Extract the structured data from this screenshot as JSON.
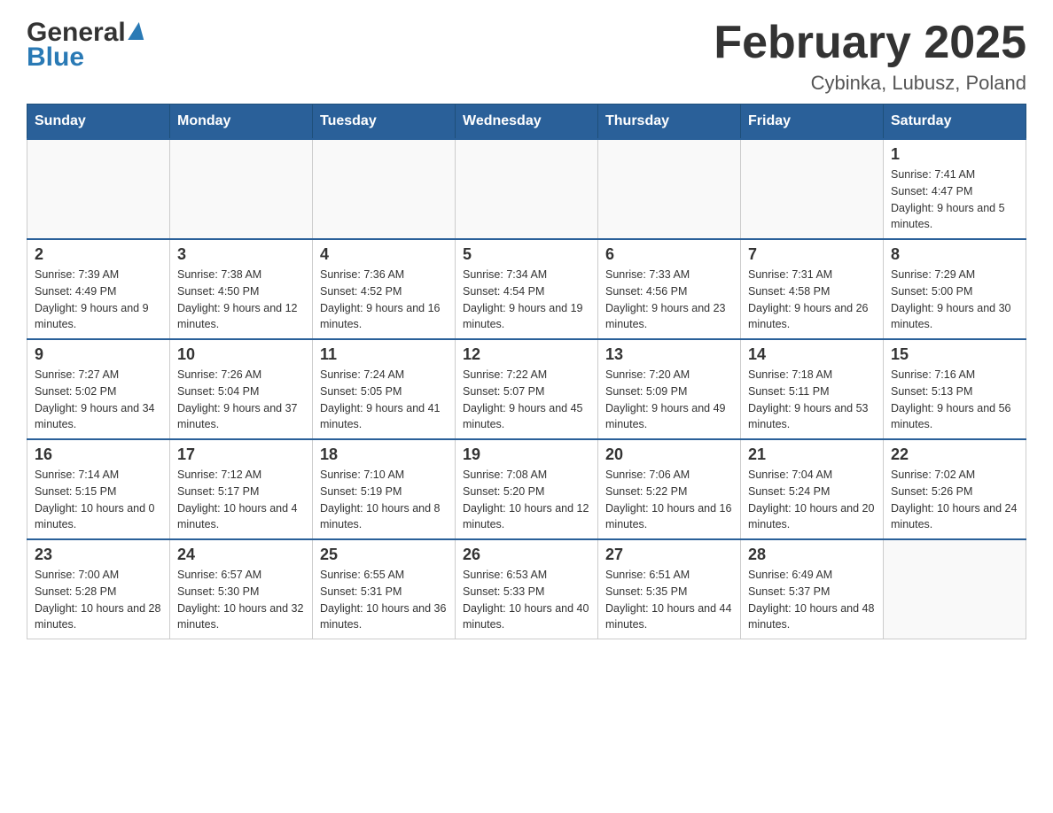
{
  "header": {
    "logo_line1": "General",
    "logo_line2": "Blue",
    "title": "February 2025",
    "subtitle": "Cybinka, Lubusz, Poland"
  },
  "weekdays": [
    "Sunday",
    "Monday",
    "Tuesday",
    "Wednesday",
    "Thursday",
    "Friday",
    "Saturday"
  ],
  "weeks": [
    {
      "days": [
        {
          "num": "",
          "info": ""
        },
        {
          "num": "",
          "info": ""
        },
        {
          "num": "",
          "info": ""
        },
        {
          "num": "",
          "info": ""
        },
        {
          "num": "",
          "info": ""
        },
        {
          "num": "",
          "info": ""
        },
        {
          "num": "1",
          "info": "Sunrise: 7:41 AM\nSunset: 4:47 PM\nDaylight: 9 hours and 5 minutes."
        }
      ]
    },
    {
      "days": [
        {
          "num": "2",
          "info": "Sunrise: 7:39 AM\nSunset: 4:49 PM\nDaylight: 9 hours and 9 minutes."
        },
        {
          "num": "3",
          "info": "Sunrise: 7:38 AM\nSunset: 4:50 PM\nDaylight: 9 hours and 12 minutes."
        },
        {
          "num": "4",
          "info": "Sunrise: 7:36 AM\nSunset: 4:52 PM\nDaylight: 9 hours and 16 minutes."
        },
        {
          "num": "5",
          "info": "Sunrise: 7:34 AM\nSunset: 4:54 PM\nDaylight: 9 hours and 19 minutes."
        },
        {
          "num": "6",
          "info": "Sunrise: 7:33 AM\nSunset: 4:56 PM\nDaylight: 9 hours and 23 minutes."
        },
        {
          "num": "7",
          "info": "Sunrise: 7:31 AM\nSunset: 4:58 PM\nDaylight: 9 hours and 26 minutes."
        },
        {
          "num": "8",
          "info": "Sunrise: 7:29 AM\nSunset: 5:00 PM\nDaylight: 9 hours and 30 minutes."
        }
      ]
    },
    {
      "days": [
        {
          "num": "9",
          "info": "Sunrise: 7:27 AM\nSunset: 5:02 PM\nDaylight: 9 hours and 34 minutes."
        },
        {
          "num": "10",
          "info": "Sunrise: 7:26 AM\nSunset: 5:04 PM\nDaylight: 9 hours and 37 minutes."
        },
        {
          "num": "11",
          "info": "Sunrise: 7:24 AM\nSunset: 5:05 PM\nDaylight: 9 hours and 41 minutes."
        },
        {
          "num": "12",
          "info": "Sunrise: 7:22 AM\nSunset: 5:07 PM\nDaylight: 9 hours and 45 minutes."
        },
        {
          "num": "13",
          "info": "Sunrise: 7:20 AM\nSunset: 5:09 PM\nDaylight: 9 hours and 49 minutes."
        },
        {
          "num": "14",
          "info": "Sunrise: 7:18 AM\nSunset: 5:11 PM\nDaylight: 9 hours and 53 minutes."
        },
        {
          "num": "15",
          "info": "Sunrise: 7:16 AM\nSunset: 5:13 PM\nDaylight: 9 hours and 56 minutes."
        }
      ]
    },
    {
      "days": [
        {
          "num": "16",
          "info": "Sunrise: 7:14 AM\nSunset: 5:15 PM\nDaylight: 10 hours and 0 minutes."
        },
        {
          "num": "17",
          "info": "Sunrise: 7:12 AM\nSunset: 5:17 PM\nDaylight: 10 hours and 4 minutes."
        },
        {
          "num": "18",
          "info": "Sunrise: 7:10 AM\nSunset: 5:19 PM\nDaylight: 10 hours and 8 minutes."
        },
        {
          "num": "19",
          "info": "Sunrise: 7:08 AM\nSunset: 5:20 PM\nDaylight: 10 hours and 12 minutes."
        },
        {
          "num": "20",
          "info": "Sunrise: 7:06 AM\nSunset: 5:22 PM\nDaylight: 10 hours and 16 minutes."
        },
        {
          "num": "21",
          "info": "Sunrise: 7:04 AM\nSunset: 5:24 PM\nDaylight: 10 hours and 20 minutes."
        },
        {
          "num": "22",
          "info": "Sunrise: 7:02 AM\nSunset: 5:26 PM\nDaylight: 10 hours and 24 minutes."
        }
      ]
    },
    {
      "days": [
        {
          "num": "23",
          "info": "Sunrise: 7:00 AM\nSunset: 5:28 PM\nDaylight: 10 hours and 28 minutes."
        },
        {
          "num": "24",
          "info": "Sunrise: 6:57 AM\nSunset: 5:30 PM\nDaylight: 10 hours and 32 minutes."
        },
        {
          "num": "25",
          "info": "Sunrise: 6:55 AM\nSunset: 5:31 PM\nDaylight: 10 hours and 36 minutes."
        },
        {
          "num": "26",
          "info": "Sunrise: 6:53 AM\nSunset: 5:33 PM\nDaylight: 10 hours and 40 minutes."
        },
        {
          "num": "27",
          "info": "Sunrise: 6:51 AM\nSunset: 5:35 PM\nDaylight: 10 hours and 44 minutes."
        },
        {
          "num": "28",
          "info": "Sunrise: 6:49 AM\nSunset: 5:37 PM\nDaylight: 10 hours and 48 minutes."
        },
        {
          "num": "",
          "info": ""
        }
      ]
    }
  ]
}
